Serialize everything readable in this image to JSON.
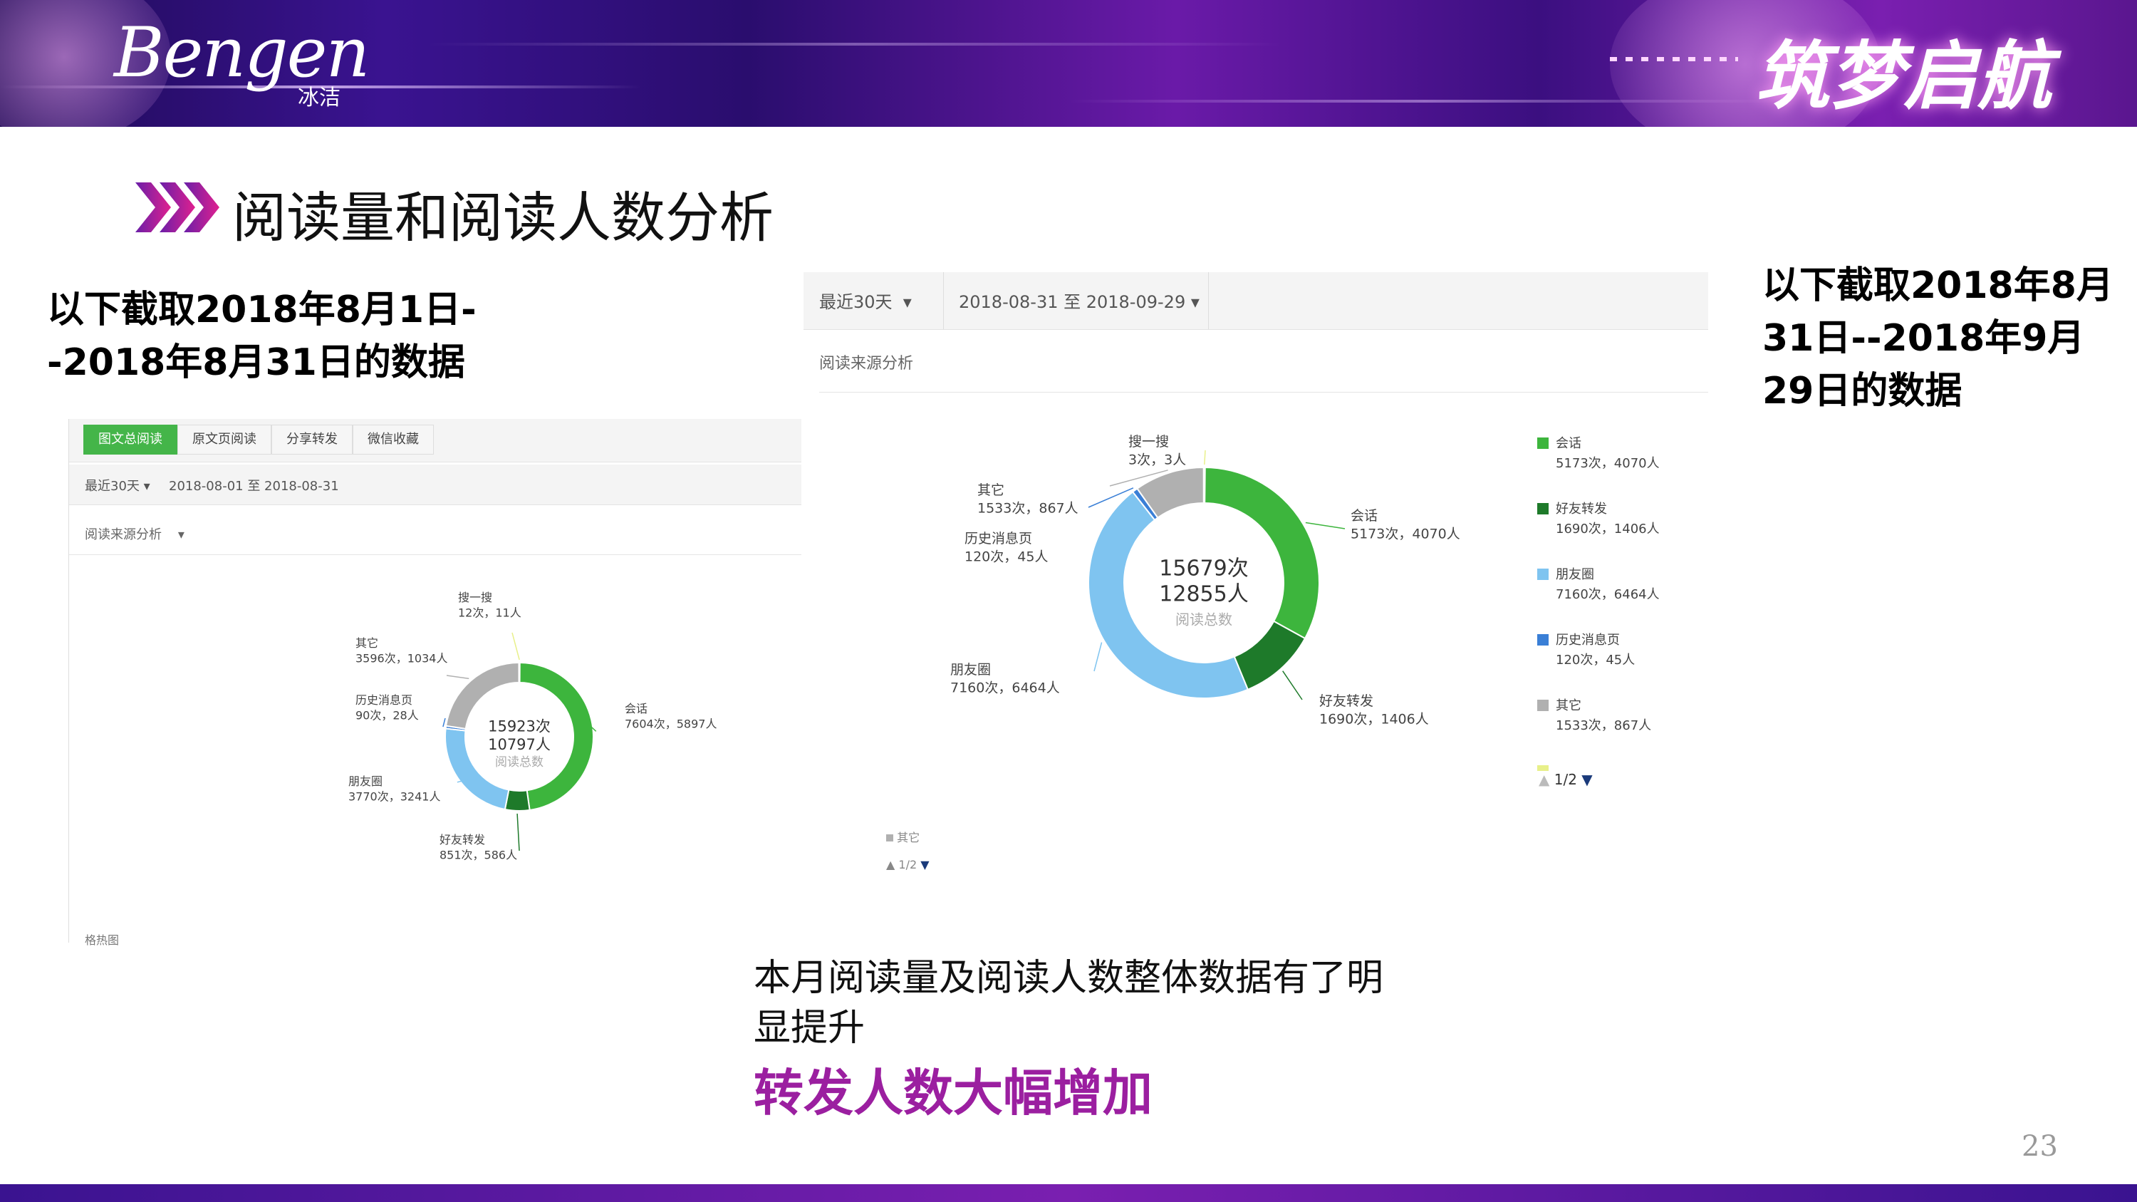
{
  "header": {
    "logo_script": "Bengen",
    "logo_cn": "冰洁",
    "slogan": "筑梦启航"
  },
  "title": "阅读量和阅读人数分析",
  "note_left": "以下截取2018年8月1日--2018年8月31日的数据",
  "note_right": "以下截取2018年8月31日--2018年9月29日的数据",
  "left_panel": {
    "tabs": [
      "图文总阅读",
      "原文页阅读",
      "分享转发",
      "微信收藏"
    ],
    "range_select": "最近30天",
    "date_range": "2018-08-01 至 2018-08-31",
    "section": "阅读来源分析",
    "fold_label": "格热图"
  },
  "right_panel": {
    "range_select": "最近30天",
    "date_range": "2018-08-31 至 2018-09-29",
    "section": "阅读来源分析",
    "pager": "1/2",
    "ghost_legend": "其它",
    "ghost_pager": "1/2"
  },
  "summary": {
    "text": "本月阅读量及阅读人数整体数据有了明显提升",
    "highlight": "转发人数大幅增加"
  },
  "page_number": "23",
  "colors": {
    "会话": "#3db53d",
    "好友转发": "#1e7a2a",
    "朋友圈": "#7fc4f0",
    "历史消息页": "#3a7fd6",
    "其它": "#b0b0b0",
    "搜一搜": "#e8f08a",
    "accent": "#9b1fa0",
    "tab_active": "#44b549"
  },
  "chart_data": [
    {
      "type": "pie",
      "variant": "donut",
      "center": {
        "line1": "15923次",
        "line2": "10797人",
        "caption": "阅读总数"
      },
      "slices": [
        {
          "name": "会话",
          "reads": 7604,
          "people": 5897,
          "label": "7604次，5897人"
        },
        {
          "name": "好友转发",
          "reads": 851,
          "people": 586,
          "label": "851次，586人"
        },
        {
          "name": "朋友圈",
          "reads": 3770,
          "people": 3241,
          "label": "3770次，3241人"
        },
        {
          "name": "历史消息页",
          "reads": 90,
          "people": 28,
          "label": "90次，28人"
        },
        {
          "name": "其它",
          "reads": 3596,
          "people": 1034,
          "label": "3596次，1034人"
        },
        {
          "name": "搜一搜",
          "reads": 12,
          "people": 11,
          "label": "12次，11人"
        }
      ]
    },
    {
      "type": "pie",
      "variant": "donut",
      "center": {
        "line1": "15679次",
        "line2": "12855人",
        "caption": "阅读总数"
      },
      "legend_position": "right",
      "slices": [
        {
          "name": "会话",
          "reads": 5173,
          "people": 4070,
          "label": "5173次，4070人"
        },
        {
          "name": "好友转发",
          "reads": 1690,
          "people": 1406,
          "label": "1690次，1406人"
        },
        {
          "name": "朋友圈",
          "reads": 7160,
          "people": 6464,
          "label": "7160次，6464人"
        },
        {
          "name": "历史消息页",
          "reads": 120,
          "people": 45,
          "label": "120次，45人"
        },
        {
          "name": "其它",
          "reads": 1533,
          "people": 867,
          "label": "1533次，867人"
        },
        {
          "name": "搜一搜",
          "reads": 3,
          "people": 3,
          "label": "3次，3人"
        }
      ]
    }
  ]
}
